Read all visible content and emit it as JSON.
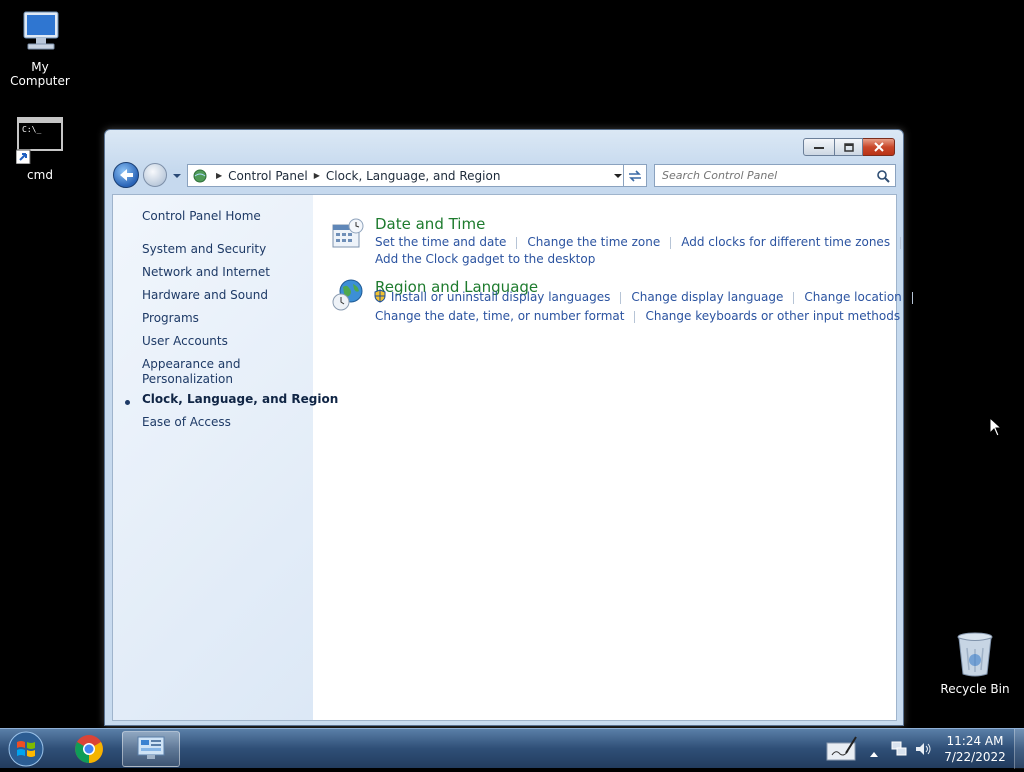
{
  "desktop": {
    "icons": [
      {
        "label": "My Computer"
      },
      {
        "label": "cmd"
      },
      {
        "label": "Recycle Bin"
      }
    ]
  },
  "window": {
    "address": {
      "segments": [
        "Control Panel",
        "Clock, Language, and Region"
      ]
    },
    "search": {
      "placeholder": "Search Control Panel"
    },
    "sidebar": {
      "home": "Control Panel Home",
      "items": [
        "System and Security",
        "Network and Internet",
        "Hardware and Sound",
        "Programs",
        "User Accounts",
        "Appearance and",
        "Personalization",
        "Clock, Language, and Region",
        "Ease of Access"
      ]
    },
    "categories": [
      {
        "title": "Date and Time",
        "links_row1": [
          "Set the time and date",
          "Change the time zone",
          "Add clocks for different time zones"
        ],
        "links_row2": [
          "Add the Clock gadget to the desktop"
        ]
      },
      {
        "title": "Region and Language",
        "links_row1": [
          "Install or uninstall display languages",
          "Change display language",
          "Change location"
        ],
        "links_row2": [
          "Change the date, time, or number format",
          "Change keyboards or other input methods"
        ]
      }
    ]
  },
  "taskbar": {
    "time": "11:24 AM",
    "date": "7/22/2022"
  }
}
